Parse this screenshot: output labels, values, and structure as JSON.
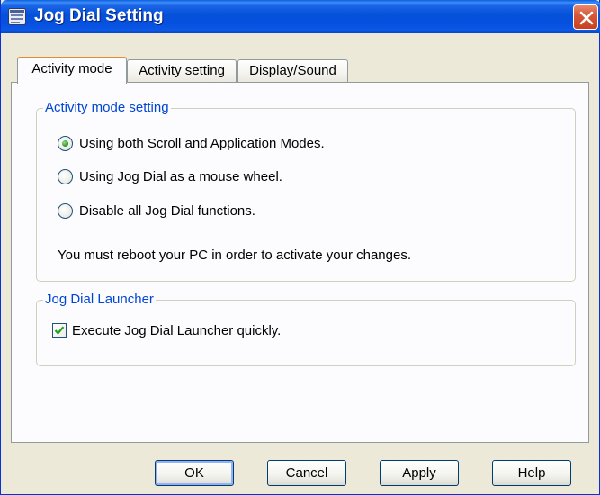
{
  "window": {
    "title": "Jog Dial Setting",
    "title_icon": "window-icon",
    "close_icon": "close-icon"
  },
  "tabs": [
    {
      "label": "Activity mode",
      "active": true
    },
    {
      "label": "Activity setting",
      "active": false
    },
    {
      "label": "Display/Sound",
      "active": false
    }
  ],
  "activity_group": {
    "title": "Activity mode setting",
    "options": [
      {
        "label": "Using both Scroll and Application Modes.",
        "selected": true
      },
      {
        "label": "Using Jog Dial as a mouse wheel.",
        "selected": false
      },
      {
        "label": "Disable all Jog Dial functions.",
        "selected": false
      }
    ],
    "note": "You must reboot your PC in order to activate your changes."
  },
  "launcher_group": {
    "title": "Jog Dial Launcher",
    "checkbox_label": "Execute Jog Dial Launcher quickly.",
    "checked": true
  },
  "buttons": {
    "ok": "OK",
    "cancel": "Cancel",
    "apply": "Apply",
    "help": "Help"
  },
  "colors": {
    "titlebar": "#0451d9",
    "group_title": "#0046d5",
    "dialog_bg": "#ece9d8",
    "tab_accent": "#e68b2c"
  }
}
